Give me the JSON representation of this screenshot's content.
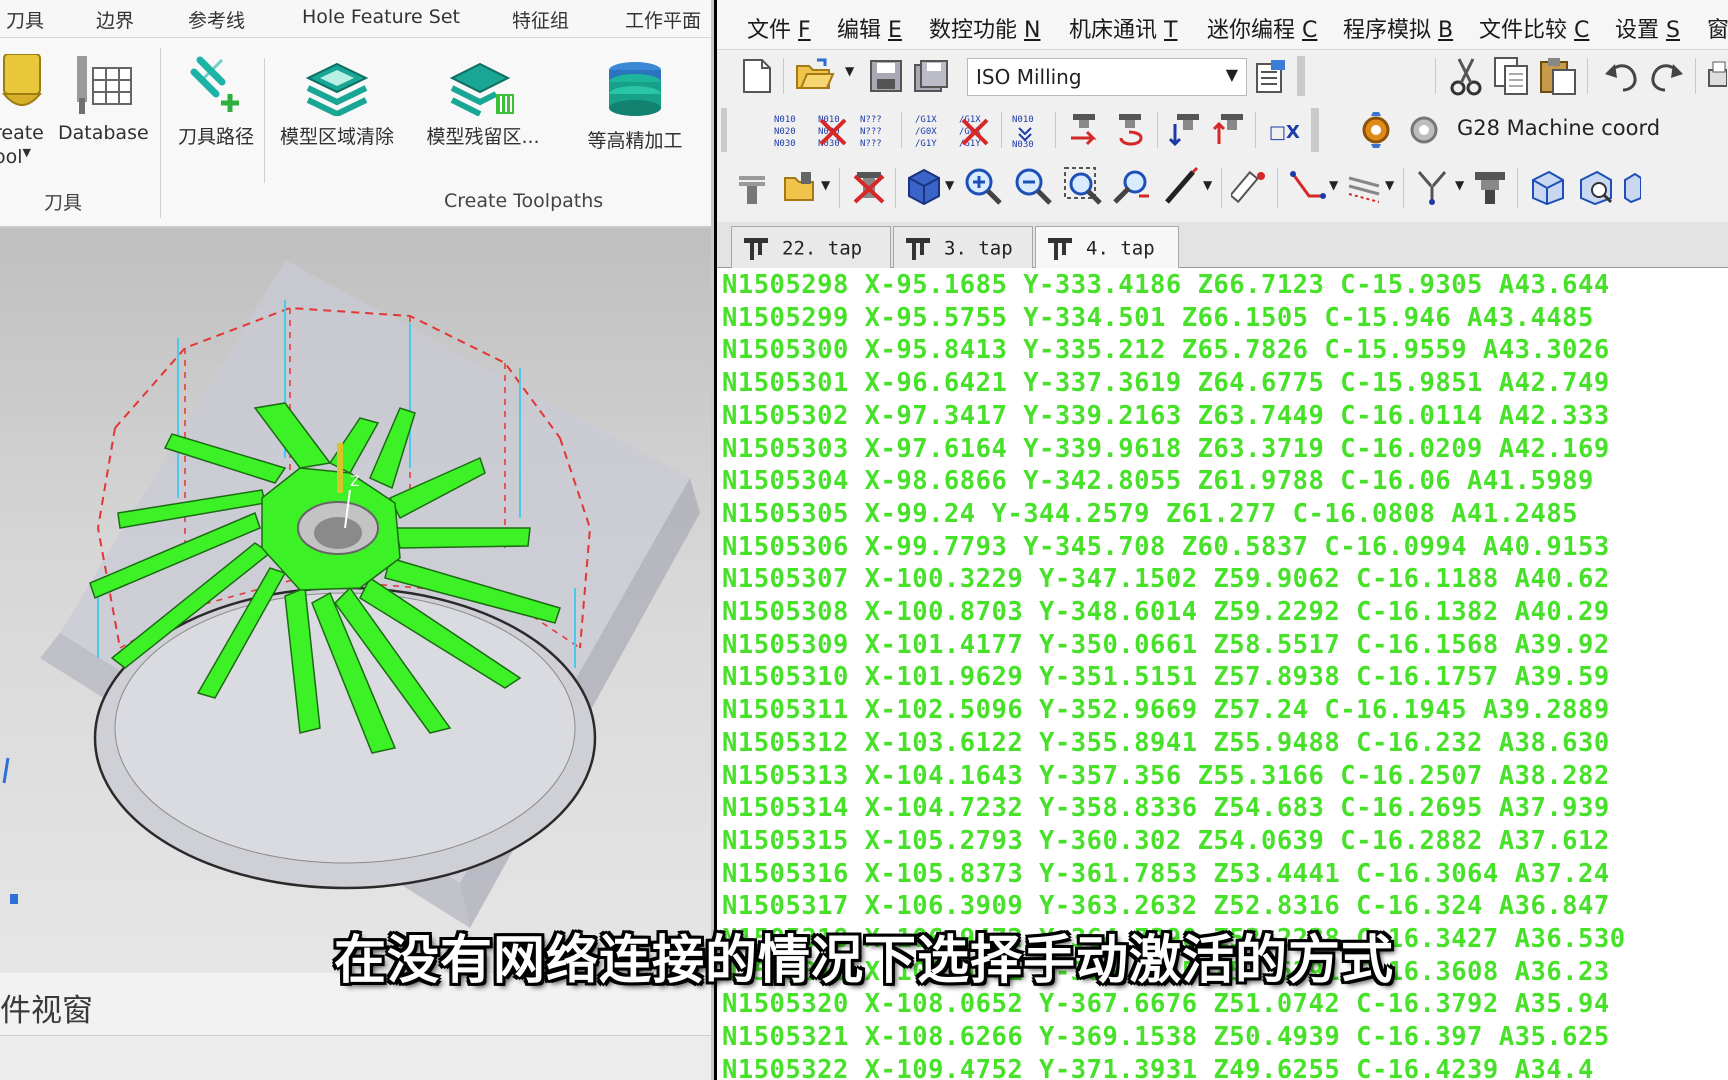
{
  "cam": {
    "ribbon_tabs": [
      "刀具",
      "边界",
      "参考线",
      "Hole Feature Set",
      "特征组",
      "工作平面"
    ],
    "tool_group": {
      "create_tool_line1": "reate",
      "create_tool_line2": "ool",
      "database": "Database",
      "group_label": "刀具"
    },
    "toolpaths_group": {
      "toolpath": "刀具路径",
      "model_area_clear": "模型区域清除",
      "model_rest": "模型残留区...",
      "constant_z": "等高精加工",
      "group_label": "Create Toolpaths"
    },
    "view_window_label": "件视窗",
    "colors": {
      "toolpath_green": "#3cf226",
      "ribbon_accent": "#16a59b"
    }
  },
  "editor": {
    "menus": [
      {
        "label": "文件",
        "key": "F"
      },
      {
        "label": "编辑",
        "key": "E"
      },
      {
        "label": "数控功能",
        "key": "N"
      },
      {
        "label": "机床通讯",
        "key": "T"
      },
      {
        "label": "迷你编程",
        "key": "C"
      },
      {
        "label": "程序模拟",
        "key": "B"
      },
      {
        "label": "文件比较",
        "key": "C"
      },
      {
        "label": "设置",
        "key": "S"
      },
      {
        "label": "窗",
        "key": ""
      }
    ],
    "machine_combo": "ISO Milling",
    "g28_label": "G28 Machine coord",
    "tabs": [
      "22. tap",
      "3. tap",
      "4. tap"
    ],
    "active_tab": "4. tap",
    "code_color": "#47e12a",
    "code_lines": [
      "N1505298 X-95.1685 Y-333.4186 Z66.7123 C-15.9305 A43.644",
      "N1505299 X-95.5755 Y-334.501 Z66.1505 C-15.946 A43.4485",
      "N1505300 X-95.8413 Y-335.212 Z65.7826 C-15.9559 A43.3026",
      "N1505301 X-96.6421 Y-337.3619 Z64.6775 C-15.9851 A42.749",
      "N1505302 X-97.3417 Y-339.2163 Z63.7449 C-16.0114 A42.333",
      "N1505303 X-97.6164 Y-339.9618 Z63.3719 C-16.0209 A42.169",
      "N1505304 X-98.6866 Y-342.8055 Z61.9788 C-16.06 A41.5989",
      "N1505305 X-99.24 Y-344.2579 Z61.277 C-16.0808 A41.2485",
      "N1505306 X-99.7793 Y-345.708 Z60.5837 C-16.0994 A40.9153",
      "N1505307 X-100.3229 Y-347.1502 Z59.9062 C-16.1188 A40.62",
      "N1505308 X-100.8703 Y-348.6014 Z59.2292 C-16.1382 A40.29",
      "N1505309 X-101.4177 Y-350.0661 Z58.5517 C-16.1568 A39.92",
      "N1505310 X-101.9629 Y-351.5151 Z57.8938 C-16.1757 A39.59",
      "N1505311 X-102.5096 Y-352.9669 Z57.24 C-16.1945 A39.2889",
      "N1505312 X-103.6122 Y-355.8941 Z55.9488 C-16.232 A38.630",
      "N1505313 X-104.1643 Y-357.356 Z55.3166 C-16.2507 A38.282",
      "N1505314 X-104.7232 Y-358.8336 Z54.683 C-16.2695 A37.939",
      "N1505315 X-105.2793 Y-360.302 Z54.0639 C-16.2882 A37.612",
      "N1505316 X-105.8373 Y-361.7853 Z53.4441 C-16.3064 A37.24",
      "N1505317 X-106.3909 Y-363.2632 Z52.8316 C-16.324 A36.847",
      "N1505318 X-106.9472 Y-364.7390 Z52.2238 C-16.3427 A36.530",
      "N1505319 X-107.5041 Y-366.2045 Z51.6391 C-16.3608 A36.23",
      "N1505320 X-108.0652 Y-367.6676 Z51.0742 C-16.3792 A35.94",
      "N1505321 X-108.6266 Y-369.1538 Z50.4939 C-16.397 A35.625",
      "N1505322 X-109.4752 Y-371.3931 Z49.6255 C-16.4239 A34.4"
    ]
  },
  "subtitle": "在没有网络连接的情况下选择手动激活的方式"
}
